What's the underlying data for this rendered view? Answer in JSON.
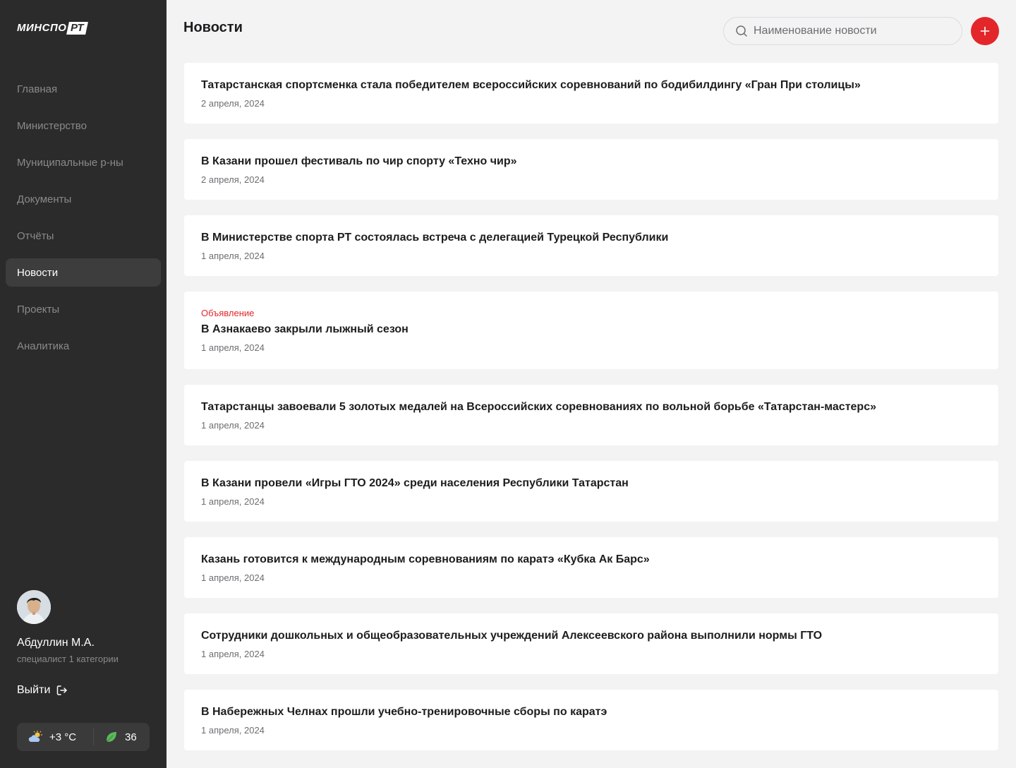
{
  "logo": {
    "part1": "МИНСПО",
    "part2": "РТ"
  },
  "sidebar": {
    "items": [
      {
        "label": "Главная",
        "active": false
      },
      {
        "label": "Министерство",
        "active": false
      },
      {
        "label": "Муниципальные р-ны",
        "active": false
      },
      {
        "label": "Документы",
        "active": false
      },
      {
        "label": "Отчёты",
        "active": false
      },
      {
        "label": "Новости",
        "active": true
      },
      {
        "label": "Проекты",
        "active": false
      },
      {
        "label": "Аналитика",
        "active": false
      }
    ]
  },
  "user": {
    "name": "Абдуллин М.А.",
    "role": "специалист 1 категории",
    "logout_label": "Выйти"
  },
  "widget": {
    "weather_icon": "partly-cloudy-icon",
    "temperature": "+3 °C",
    "aqi_icon": "leaf-icon",
    "aqi_value": "36"
  },
  "header": {
    "title": "Новости"
  },
  "search": {
    "placeholder": "Наименование новости",
    "value": ""
  },
  "add_button": {
    "icon": "plus-icon"
  },
  "news": [
    {
      "tag": "",
      "title": "Татарстанская спортсменка стала победителем всероссийских соревнований по бодибилдингу «Гран При столицы»",
      "date": "2 апреля, 2024"
    },
    {
      "tag": "",
      "title": "В Казани прошел фестиваль по чир спорту «Техно чир»",
      "date": "2 апреля, 2024"
    },
    {
      "tag": "",
      "title": "В Министерстве спорта РТ состоялась встреча с делегацией Турецкой Республики",
      "date": "1 апреля, 2024"
    },
    {
      "tag": "Объявление",
      "title": "В Азнакаево закрыли лыжный сезон",
      "date": "1 апреля, 2024"
    },
    {
      "tag": "",
      "title": "Татарстанцы завоевали 5 золотых медалей на Всероссийских соревнованиях по вольной борьбе «Татарстан-мастерс»",
      "date": "1 апреля, 2024"
    },
    {
      "tag": "",
      "title": "В Казани провели «Игры ГТО 2024» среди населения Республики Татарстан",
      "date": "1 апреля, 2024"
    },
    {
      "tag": "",
      "title": "Казань готовится к международным соревнованиям по каратэ «Кубка Ак Барс»",
      "date": "1 апреля, 2024"
    },
    {
      "tag": "",
      "title": "Сотрудники дошкольных и общеобразовательных учреждений Алексеевского района выполнили нормы ГТО",
      "date": "1 апреля, 2024"
    },
    {
      "tag": "",
      "title": "В Набережных Челнах прошли учебно-тренировочные сборы по каратэ",
      "date": "1 апреля, 2024"
    }
  ],
  "colors": {
    "sidebar_bg": "#2b2b2b",
    "accent": "#e3262a",
    "page_bg": "#f3f3f4"
  }
}
